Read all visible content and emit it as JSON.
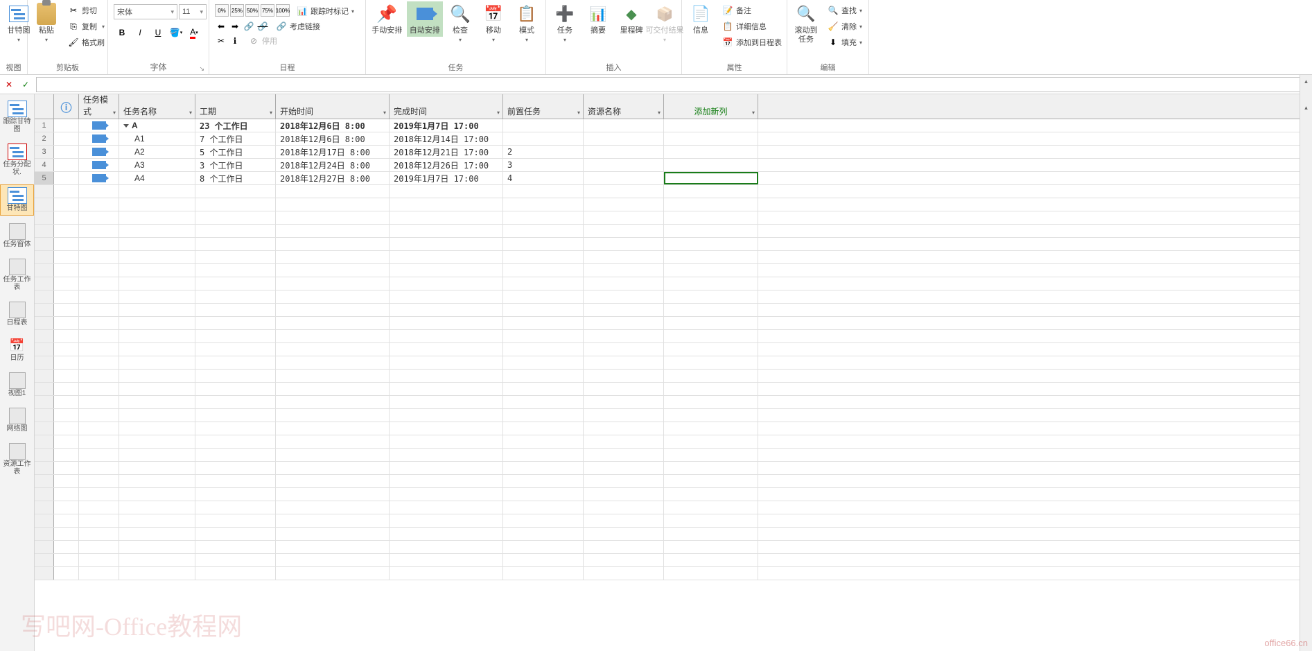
{
  "ribbon": {
    "groups": {
      "view": "视图",
      "clipboard": "剪贴板",
      "font": "字体",
      "schedule": "日程",
      "tasks": "任务",
      "insert": "插入",
      "properties": "属性",
      "editing": "编辑"
    },
    "gantt_label": "甘特图",
    "paste_label": "粘贴",
    "cut": "剪切",
    "copy": "复制",
    "format_painter": "格式刷",
    "font_name": "宋体",
    "font_size": "11",
    "pct_labels": [
      "0%",
      "25%",
      "50%",
      "75%",
      "100%"
    ],
    "mark_on_track": "跟踪时标记",
    "respect_links": "考虑链接",
    "inactivate": "停用",
    "manual": "手动安排",
    "auto": "自动安排",
    "inspect": "检查",
    "move": "移动",
    "mode": "模式",
    "task": "任务",
    "summary": "摘要",
    "milestone": "里程碑",
    "deliverable": "可交付结果",
    "information": "信息",
    "notes": "备注",
    "details": "详细信息",
    "add_to_timeline": "添加到日程表",
    "scroll_to_task": "滚动到任务",
    "find": "查找",
    "clear": "清除",
    "fill": "填充"
  },
  "sidebar": {
    "tracking_gantt": "跟踪甘特图",
    "task_usage": "任务分配状.",
    "gantt": "甘特图",
    "task_form": "任务窗体",
    "task_sheet": "任务工作表",
    "timeline": "日程表",
    "calendar": "日历",
    "view1": "视图1",
    "network": "网络图",
    "resource_sheet": "资源工作表"
  },
  "columns": {
    "info": "ⓘ",
    "mode": "任务模式",
    "name": "任务名称",
    "duration": "工期",
    "start": "开始时间",
    "finish": "完成时间",
    "predecessors": "前置任务",
    "resources": "资源名称",
    "add": "添加新列"
  },
  "rows": [
    {
      "num": "1",
      "name": "A",
      "indent": 0,
      "bold": true,
      "dur": "23 个工作日",
      "start": "2018年12月6日 8:00",
      "end": "2019年1月7日 17:00",
      "pred": "",
      "outline": true
    },
    {
      "num": "2",
      "name": "A1",
      "indent": 1,
      "bold": false,
      "dur": "7 个工作日",
      "start": "2018年12月6日 8:00",
      "end": "2018年12月14日 17:00",
      "pred": ""
    },
    {
      "num": "3",
      "name": "A2",
      "indent": 1,
      "bold": false,
      "dur": "5 个工作日",
      "start": "2018年12月17日 8:00",
      "end": "2018年12月21日 17:00",
      "pred": "2"
    },
    {
      "num": "4",
      "name": "A3",
      "indent": 1,
      "bold": false,
      "dur": "3 个工作日",
      "start": "2018年12月24日 8:00",
      "end": "2018年12月26日 17:00",
      "pred": "3"
    },
    {
      "num": "5",
      "name": "A4",
      "indent": 1,
      "bold": false,
      "dur": "8 个工作日",
      "start": "2018年12月27日 8:00",
      "end": "2019年1月7日 17:00",
      "pred": "4",
      "selected": true
    }
  ],
  "watermark": "写吧网-Office教程网",
  "watermark2": "office66.cn"
}
